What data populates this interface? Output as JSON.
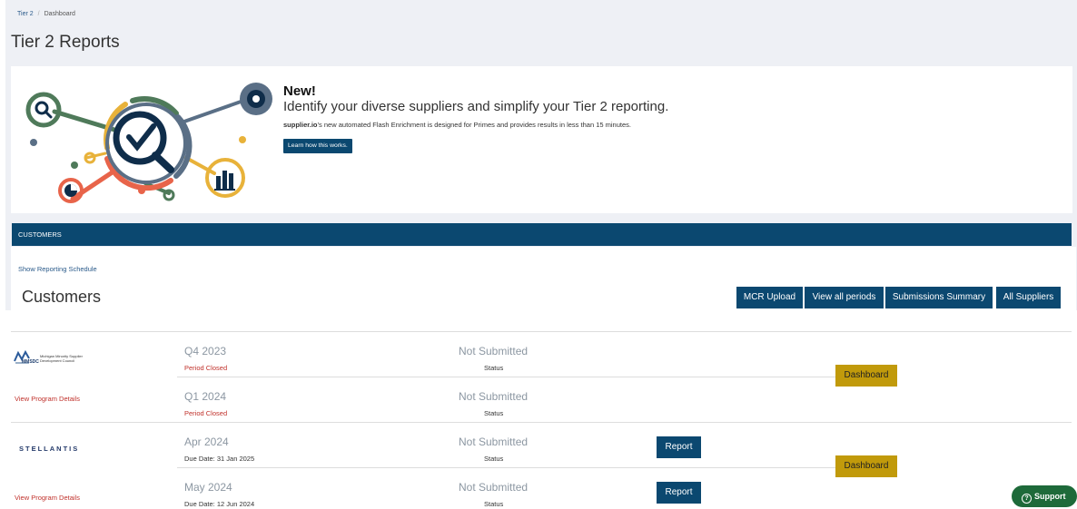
{
  "breadcrumb": {
    "items": [
      "Tier 2",
      "Dashboard"
    ]
  },
  "page": {
    "title": "Tier 2 Reports"
  },
  "banner": {
    "new_label": "New!",
    "headline": "Identify your diverse suppliers and simplify your Tier 2 reporting.",
    "brand": "supplier.io",
    "description": "’s new automated Flash Enrichment is designed for Primes and provides results in less than 15 minutes.",
    "cta_label": "Learn how this works."
  },
  "customers_bar": {
    "label": "CUSTOMERS"
  },
  "customers": {
    "show_schedule": "Show Reporting Schedule",
    "heading": "Customers",
    "buttons": {
      "mcr_upload": "MCR Upload",
      "view_periods": "View all periods",
      "submissions_summary": "Submissions Summary",
      "all_suppliers": "All Suppliers"
    }
  },
  "customer_rows": [
    {
      "logo_text": "MMSDC",
      "logo_full": [
        "Michigan Minority Supplier",
        "Development Council"
      ],
      "view_details": "View Program Details",
      "dashboard_label": "Dashboard",
      "periods": [
        {
          "name": "Q4 2023",
          "sub": "Period Closed",
          "status": "Not Submitted",
          "status_label": "Status"
        },
        {
          "name": "Q1 2024",
          "sub": "Period Closed",
          "status": "Not Submitted",
          "status_label": "Status"
        }
      ]
    },
    {
      "logo_text": "STELLANTIS",
      "view_details": "View Program Details",
      "dashboard_label": "Dashboard",
      "periods": [
        {
          "name": "Apr 2024",
          "sub": "Due Date: 31 Jan 2025",
          "status": "Not Submitted",
          "status_label": "Status",
          "report_label": "Report"
        },
        {
          "name": "May 2024",
          "sub": "Due Date: 12 Jun 2024",
          "status": "Not Submitted",
          "status_label": "Status",
          "report_label": "Report"
        }
      ]
    }
  ],
  "support": {
    "label": "Support"
  },
  "colors": {
    "primary": "#0b4870",
    "dashboard": "#c19a0b",
    "closed": "#c0312b",
    "support": "#1e6a3a"
  }
}
